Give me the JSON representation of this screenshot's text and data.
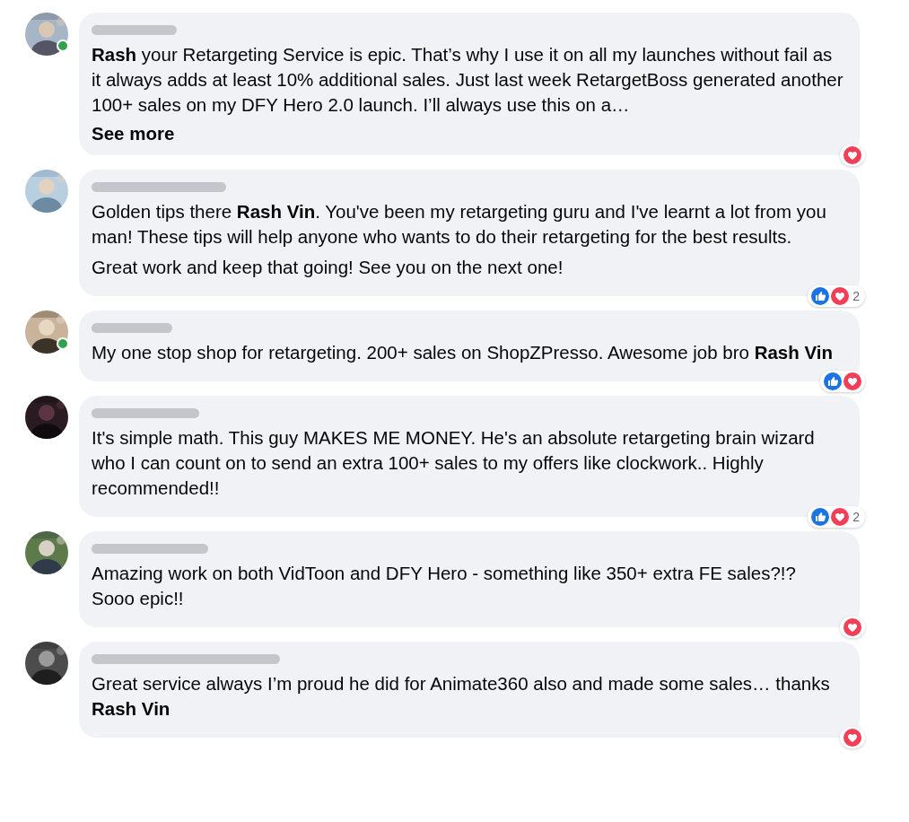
{
  "comments": [
    {
      "online": true,
      "paragraphs": [
        "**Rash** your Retargeting Service is epic. That’s why I use it on all my launches without fail as it always adds at least 10% additional sales. Just last week RetargetBoss generated another 100+ sales on my DFY Hero 2.0 launch. I’ll always use this on a…"
      ],
      "see_more": "See more",
      "like": false,
      "love": true
    },
    {
      "online": false,
      "paragraphs": [
        "Golden tips there **Rash Vin**. You've been my retargeting guru and I've learnt a lot from you man! These tips will help anyone who wants to do their retargeting for the best results.",
        "Great work and keep that going! See you on the next one!"
      ],
      "like": true,
      "love": true,
      "reaction_count": "2"
    },
    {
      "online": true,
      "paragraphs": [
        "My one stop shop for retargeting. 200+ sales on ShopZPresso. Awesome job bro **Rash Vin**"
      ],
      "like": true,
      "love": true
    },
    {
      "online": false,
      "paragraphs": [
        "It's simple math. This guy MAKES ME MONEY. He's an absolute retargeting brain wizard who I can count on to send an extra 100+ sales to my offers like clockwork.. Highly recommended!!"
      ],
      "like": true,
      "love": true,
      "reaction_count": "2"
    },
    {
      "online": false,
      "paragraphs": [
        "Amazing work on both VidToon and DFY Hero - something like 350+ extra FE sales?!? Sooo epic!!"
      ],
      "like": false,
      "love": true
    },
    {
      "online": false,
      "paragraphs": [
        "Great service always I’m proud he did for Animate360 also and made some sales… thanks **Rash Vin**"
      ],
      "like": false,
      "love": true
    }
  ]
}
